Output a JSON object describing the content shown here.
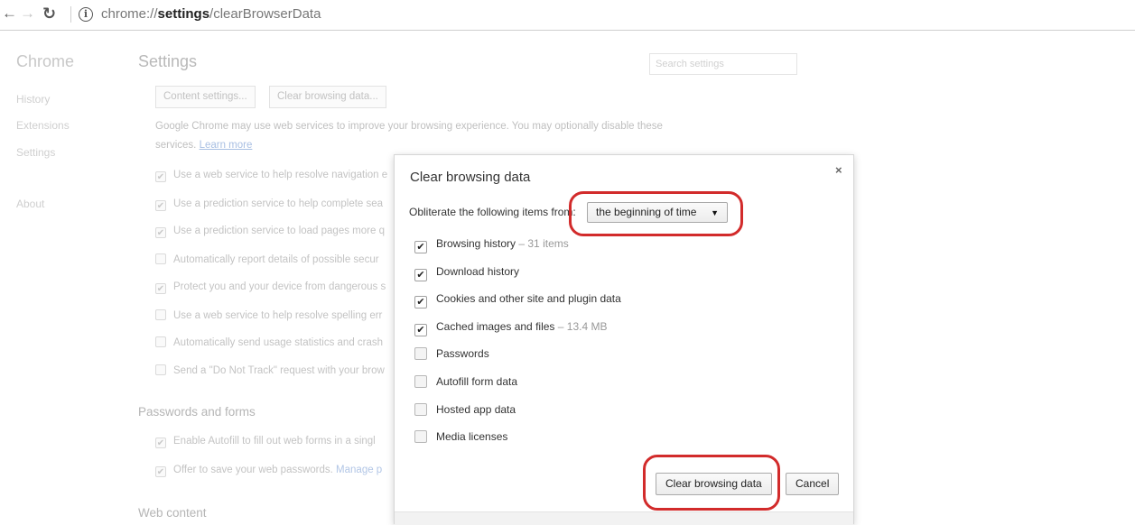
{
  "browser": {
    "url_prefix": "chrome://",
    "url_bold": "settings",
    "url_suffix": "/clearBrowserData",
    "icons": {
      "back": "back-arrow-icon",
      "forward": "forward-arrow-icon",
      "reload": "reload-icon",
      "info": "info-icon"
    }
  },
  "sidebar": {
    "brand": "Chrome",
    "items": [
      {
        "label": "History"
      },
      {
        "label": "Extensions"
      },
      {
        "label": "Settings"
      },
      {
        "label": "About"
      }
    ]
  },
  "settings": {
    "title": "Settings",
    "search_placeholder": "Search settings",
    "buttons": {
      "content_settings": "Content settings...",
      "clear_browsing_data": "Clear browsing data..."
    },
    "privacy_text_1": "Google Chrome may use web services to improve your browsing experience. You may optionally disable these",
    "privacy_text_2": "services.",
    "learn_more": "Learn more",
    "privacy_options": [
      {
        "label": "Use a web service to help resolve navigation e",
        "checked": true
      },
      {
        "label": "Use a prediction service to help complete sea",
        "checked": true
      },
      {
        "label": "Use a prediction service to load pages more q",
        "checked": true
      },
      {
        "label": "Automatically report details of possible secur",
        "checked": false
      },
      {
        "label": "Protect you and your device from dangerous s",
        "checked": true
      },
      {
        "label": "Use a web service to help resolve spelling err",
        "checked": false
      },
      {
        "label": "Automatically send usage statistics and crash",
        "checked": false
      },
      {
        "label": "Send a \"Do Not Track\" request with your brow",
        "checked": false
      }
    ],
    "passwords_heading": "Passwords and forms",
    "password_options": [
      {
        "label": "Enable Autofill to fill out web forms in a singl",
        "checked": true
      },
      {
        "label": "Offer to save your web passwords.",
        "link": "Manage p",
        "checked": true
      }
    ],
    "web_content_heading": "Web content"
  },
  "dialog": {
    "title": "Clear browsing data",
    "close_symbol": "×",
    "obliterate_label": "Obliterate the following items from:",
    "time_range": "the beginning of time",
    "caret": "▼",
    "items": [
      {
        "label": "Browsing history",
        "detail": "–  31 items",
        "checked": true
      },
      {
        "label": "Download history",
        "detail": "",
        "checked": true
      },
      {
        "label": "Cookies and other site and plugin data",
        "detail": "",
        "checked": true
      },
      {
        "label": "Cached images and files",
        "detail": "–  13.4 MB",
        "checked": true
      },
      {
        "label": "Passwords",
        "detail": "",
        "checked": false
      },
      {
        "label": "Autofill form data",
        "detail": "",
        "checked": false
      },
      {
        "label": "Hosted app data",
        "detail": "",
        "checked": false
      },
      {
        "label": "Media licenses",
        "detail": "",
        "checked": false
      }
    ],
    "clear_button": "Clear browsing data",
    "cancel_button": "Cancel",
    "checkmark": "✔"
  },
  "colors": {
    "highlight": "#d22b2b",
    "link": "#a8bfe3"
  }
}
